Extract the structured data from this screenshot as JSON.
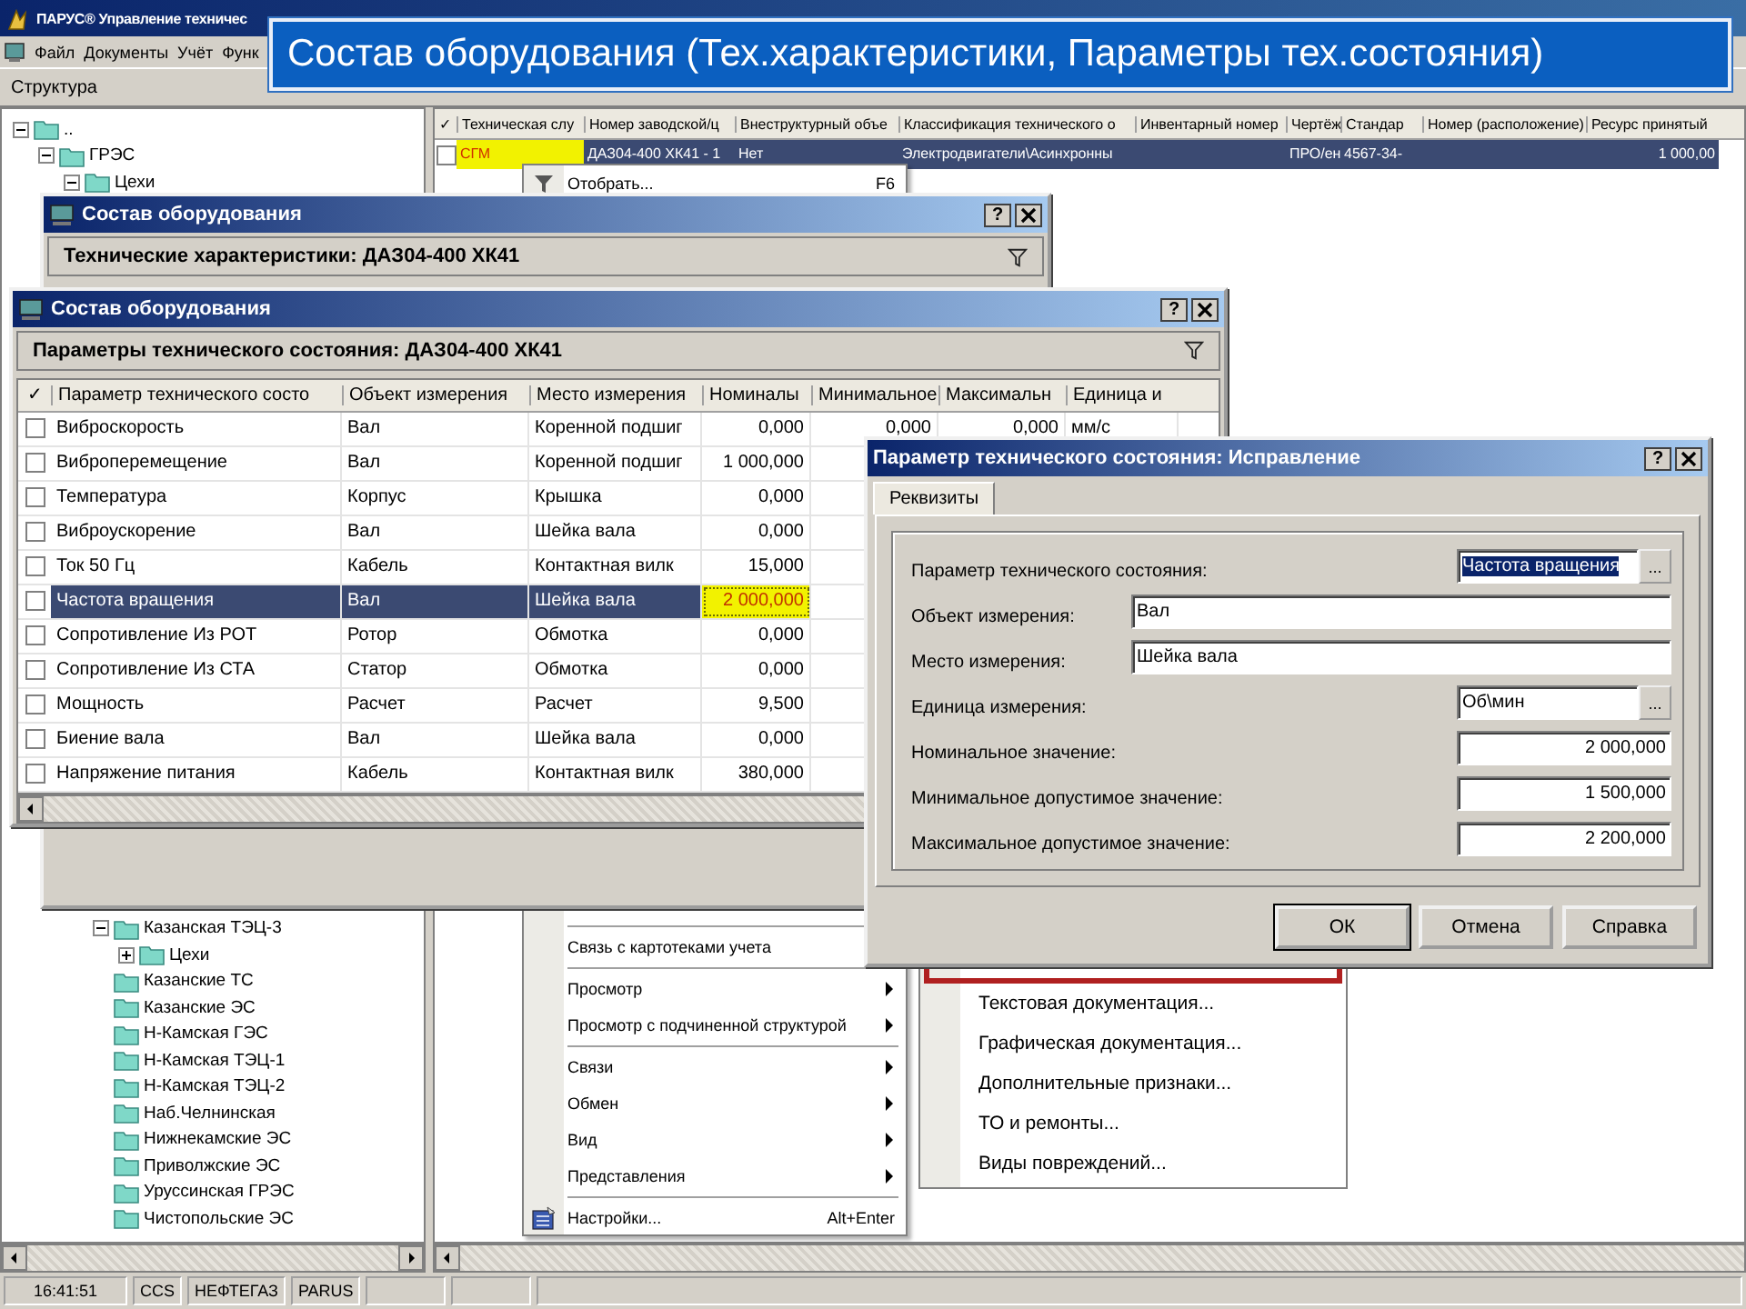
{
  "app": {
    "title": "ПАРУС® Управление техничес",
    "menu": [
      "Файл",
      "Документы",
      "Учёт",
      "Функ"
    ],
    "toolbar_label": "Структура"
  },
  "banner": "Состав оборудования (Тех.характеристики, Параметры тех.состояния)",
  "tree_top": [
    {
      "label": "..",
      "expanded": true,
      "children": [
        {
          "label": "ГРЭС",
          "expanded": true,
          "children": [
            {
              "label": "Цехи",
              "expanded": true
            }
          ]
        }
      ]
    }
  ],
  "tree_bottom": [
    {
      "label": "Казанская ТЭЦ-3",
      "expanded": true,
      "children": [
        {
          "label": "Цехи",
          "expanded": false
        }
      ]
    },
    {
      "label": "Казанские    ТС"
    },
    {
      "label": "Казанские    ЭС"
    },
    {
      "label": "Н-Камская ГЭС"
    },
    {
      "label": "Н-Камская ТЭЦ-1"
    },
    {
      "label": "Н-Камская ТЭЦ-2"
    },
    {
      "label": "Наб.Челнинская"
    },
    {
      "label": "Нижнекамские  ЭС"
    },
    {
      "label": "Приволжские   ЭС"
    },
    {
      "label": "Уруссинская ГРЭС"
    },
    {
      "label": "Чистопольские ЭС"
    }
  ],
  "main_grid": {
    "check_header": "✓",
    "columns": [
      "Техническая слу",
      "Номер заводской/ц",
      "Внеструктурный объе",
      "Классификация технического о",
      "Инвентарный номер",
      "Чертёж",
      "Стандар",
      "Номер (расположение)",
      "Ресурс принятый"
    ],
    "rows": [
      {
        "selected": true,
        "checked": false,
        "cells": [
          {
            "text": "СГМ",
            "highlighted": true
          },
          {
            "text": "ДАЗ04-400 ХК41 - 1",
            "highlighted": false
          },
          {
            "text": "Нет",
            "highlighted": false
          },
          {
            "text": "Электродвигатели\\Асинхронны",
            "highlighted": false
          },
          {
            "highlighted": false
          },
          {
            "text": "ПРО/ен",
            "highlighted": false
          },
          {
            "text": "4567-34-",
            "highlighted": false
          },
          {
            "highlighted": false
          },
          {
            "text": "1 000,00",
            "highlighted": false
          }
        ]
      }
    ]
  },
  "context_menu": {
    "top_items": [
      {
        "label": "Отобрать...",
        "shortcut": "F6",
        "has_icon": true,
        "submenu": false,
        "separator_before": false
      }
    ],
    "bottom_items": [
      {
        "label": "Связь с картотеками учета",
        "has_icon": false,
        "submenu": false,
        "separator_before": true
      },
      {
        "label": "Просмотр",
        "has_icon": false,
        "submenu": true,
        "separator_before": true
      },
      {
        "label": "Просмотр с подчиненной структурой",
        "has_icon": false,
        "submenu": true,
        "separator_before": false
      },
      {
        "label": "Связи",
        "has_icon": false,
        "submenu": true,
        "separator_before": true
      },
      {
        "label": "Обмен",
        "has_icon": false,
        "submenu": true,
        "separator_before": false
      },
      {
        "label": "Вид",
        "has_icon": false,
        "submenu": true,
        "separator_before": false
      },
      {
        "label": "Представления",
        "has_icon": false,
        "submenu": true,
        "separator_before": false
      },
      {
        "label": "Настройки...",
        "shortcut": "Alt+Enter",
        "has_icon": true,
        "submenu": false,
        "separator_before": true
      }
    ]
  },
  "submenu": {
    "items": [
      {
        "selected": true
      },
      {
        "label": "Текстовая документация...",
        "selected": false
      },
      {
        "label": "Графическая документация...",
        "selected": false
      },
      {
        "label": "Дополнительные признаки...",
        "selected": false
      },
      {
        "label": "ТО и ремонты...",
        "selected": false
      },
      {
        "label": "Виды повреждений...",
        "selected": false
      }
    ]
  },
  "window_characteristics": {
    "title": "Состав оборудования",
    "help": "?",
    "header": "Технические характеристики: ДАЗ04-400 ХК41"
  },
  "window_parameters": {
    "title": "Состав оборудования",
    "help": "?",
    "header": "Параметры технического состояния: ДАЗ04-400 ХК41",
    "table": {
      "check_header": "✓",
      "columns": [
        "Параметр технического состо",
        "Объект измерения",
        "Место измерения",
        "Номиналы",
        "Минимальное",
        "Максимальн",
        "Единица и"
      ],
      "rows": [
        {
          "selected": false,
          "checked": false,
          "cells": [
            {
              "text": "Виброскорость",
              "highlighted": false
            },
            {
              "text": "Вал",
              "highlighted": false
            },
            {
              "text": "Коренной подшиг",
              "highlighted": false
            },
            {
              "text": "0,000",
              "highlighted": false
            },
            {
              "text": "0,000",
              "highlighted": false
            },
            {
              "text": "0,000",
              "highlighted": false
            },
            {
              "text": "мм/с",
              "highlighted": false
            }
          ]
        },
        {
          "selected": false,
          "checked": false,
          "cells": [
            {
              "text": "Виброперемещение",
              "highlighted": false
            },
            {
              "text": "Вал",
              "highlighted": false
            },
            {
              "text": "Коренной подшиг",
              "highlighted": false
            },
            {
              "text": "1 000,000",
              "highlighted": false
            }
          ]
        },
        {
          "selected": false,
          "checked": false,
          "cells": [
            {
              "text": "Температура",
              "highlighted": false
            },
            {
              "text": "Корпус",
              "highlighted": false
            },
            {
              "text": "Крышка",
              "highlighted": false
            },
            {
              "text": "0,000",
              "highlighted": false
            }
          ]
        },
        {
          "selected": false,
          "checked": false,
          "cells": [
            {
              "text": "Виброускорение",
              "highlighted": false
            },
            {
              "text": "Вал",
              "highlighted": false
            },
            {
              "text": "Шейка вала",
              "highlighted": false
            },
            {
              "text": "0,000",
              "highlighted": false
            }
          ]
        },
        {
          "selected": false,
          "checked": false,
          "cells": [
            {
              "text": "Ток 50 Гц",
              "highlighted": false
            },
            {
              "text": "Кабель",
              "highlighted": false
            },
            {
              "text": "Контактная вилк",
              "highlighted": false
            },
            {
              "text": "15,000",
              "highlighted": false
            }
          ]
        },
        {
          "selected": true,
          "checked": false,
          "cells": [
            {
              "text": "Частота вращения",
              "highlighted": false
            },
            {
              "text": "Вал",
              "highlighted": false
            },
            {
              "text": "Шейка вала",
              "highlighted": false
            },
            {
              "text": "2 000,000",
              "highlighted": true
            }
          ]
        },
        {
          "selected": false,
          "checked": false,
          "cells": [
            {
              "text": "Сопротивление Из РОТ",
              "highlighted": false
            },
            {
              "text": "Ротор",
              "highlighted": false
            },
            {
              "text": "Обмотка",
              "highlighted": false
            },
            {
              "text": "0,000",
              "highlighted": false
            }
          ]
        },
        {
          "selected": false,
          "checked": false,
          "cells": [
            {
              "text": "Сопротивление Из СТА",
              "highlighted": false
            },
            {
              "text": "Статор",
              "highlighted": false
            },
            {
              "text": "Обмотка",
              "highlighted": false
            },
            {
              "text": "0,000",
              "highlighted": false
            }
          ]
        },
        {
          "selected": false,
          "checked": false,
          "cells": [
            {
              "text": "Мощность",
              "highlighted": false
            },
            {
              "text": "Расчет",
              "highlighted": false
            },
            {
              "text": "Расчет",
              "highlighted": false
            },
            {
              "text": "9,500",
              "highlighted": false
            }
          ]
        },
        {
          "selected": false,
          "checked": false,
          "cells": [
            {
              "text": "Биение вала",
              "highlighted": false
            },
            {
              "text": "Вал",
              "highlighted": false
            },
            {
              "text": "Шейка вала",
              "highlighted": false
            },
            {
              "text": "0,000",
              "highlighted": false
            }
          ]
        },
        {
          "selected": false,
          "checked": false,
          "cells": [
            {
              "text": "Напряжение питания",
              "highlighted": false
            },
            {
              "text": "Кабель",
              "highlighted": false
            },
            {
              "text": "Контактная вилк",
              "highlighted": false
            },
            {
              "text": "380,000",
              "highlighted": false
            }
          ]
        }
      ]
    }
  },
  "dialog": {
    "title": "Параметр технического состояния: Исправление",
    "help": "?",
    "tabs": [
      {
        "label": "Реквизиты",
        "selected": true
      }
    ],
    "fields": [
      {
        "label": "Параметр технического состояния:",
        "value": "Частота вращения",
        "kind": "picker",
        "button": "...",
        "focused": true
      },
      {
        "label": "Объект измерения:",
        "value": "Вал",
        "kind": "text",
        "focused": false
      },
      {
        "label": "Место измерения:",
        "value": "Шейка вала",
        "kind": "text",
        "focused": false
      },
      {
        "label": "Единица измерения:",
        "value": "Об\\мин",
        "kind": "picker",
        "button": "...",
        "focused": false
      },
      {
        "label": "Номинальное значение:",
        "value": "2 000,000",
        "kind": "number",
        "focused": false
      },
      {
        "label": "Минимальное допустимое значение:",
        "value": "1 500,000",
        "kind": "number",
        "focused": false
      },
      {
        "label": "Максимальное допустимое значение:",
        "value": "2 200,000",
        "kind": "number",
        "focused": false
      }
    ],
    "buttons": [
      {
        "label": "ОК",
        "default": true
      },
      {
        "label": "Отмена",
        "default": false
      },
      {
        "label": "Справка",
        "default": false
      }
    ]
  },
  "status_bar": [
    "16:41:51",
    "CCS",
    "НЕФТЕГАЗ",
    "PARUS"
  ]
}
